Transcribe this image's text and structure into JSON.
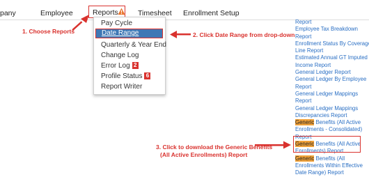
{
  "nav": {
    "items": [
      {
        "key": "company",
        "label": "pany"
      },
      {
        "key": "employee",
        "label": "Employee"
      },
      {
        "key": "reports",
        "label": "Reports"
      },
      {
        "key": "timesheet",
        "label": "Timesheet"
      },
      {
        "key": "enrollment",
        "label": "Enrollment Setup"
      }
    ]
  },
  "dropdown": {
    "items": [
      "Pay Cycle",
      "Date Range",
      "Quarterly & Year End",
      "Change Log",
      "Error Log",
      "Profile Status",
      "Report Writer"
    ],
    "selected": "Date Range",
    "error_log_count": "2",
    "profile_status_count": "6"
  },
  "annotations": {
    "step1": "1. Choose Reports",
    "step2": "2. Click Date Range from drop-down",
    "step3_line1": "3. Click to download the Generic Benefits",
    "step3_line2": "(All Active Enrollments) Report"
  },
  "reports": {
    "lines": [
      "Report",
      "Employee Tax Breakdown",
      "Report",
      "Enrollment Status By Coverage",
      "Line Report",
      "Estimated Annual GT Imputed",
      "Income Report",
      "General Ledger Report",
      "General Ledger By Employee",
      "Report",
      "General Ledger Mappings",
      "Report",
      "General Ledger Mappings",
      "Discrepancies Report"
    ],
    "generic_1": {
      "hl": "Generic",
      "rest": " Benefits (All Active",
      "line2": "Enrollments - Consolidated)",
      "line3": "Report"
    },
    "generic_2": {
      "hl": "Generic",
      "rest": " Benefits (All Active",
      "line2": "Enrollments) Report"
    },
    "generic_3": {
      "hl": "Generic",
      "rest": " Benefits (All",
      "line2": "Enrollments Within Effective",
      "line3": "Date Range) Report"
    }
  },
  "colors": {
    "accent_red": "#d9322e",
    "link_blue": "#2a6fc4",
    "selected_blue": "#3f78b5",
    "highlight_orange": "#f1a23a"
  }
}
